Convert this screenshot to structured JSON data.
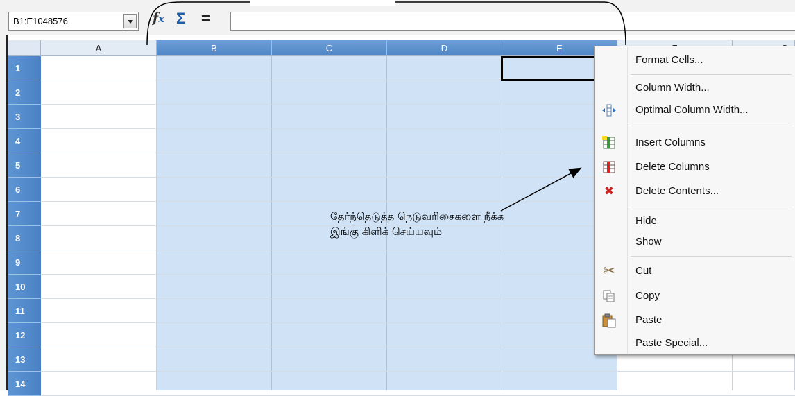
{
  "formula_bar": {
    "name_box": "B1:E1048576",
    "formula": ""
  },
  "columns": [
    {
      "name": "A",
      "selected": false
    },
    {
      "name": "B",
      "selected": true
    },
    {
      "name": "C",
      "selected": true
    },
    {
      "name": "D",
      "selected": true
    },
    {
      "name": "E",
      "selected": true
    },
    {
      "name": "F",
      "selected": false
    },
    {
      "name": "G",
      "selected": false
    }
  ],
  "rows": [
    "1",
    "2",
    "3",
    "4",
    "5",
    "6",
    "7",
    "8",
    "9",
    "10",
    "11",
    "12",
    "13",
    "14"
  ],
  "context_menu": {
    "items": [
      {
        "label": "Format Cells...",
        "icon": ""
      },
      {
        "label": "Column Width...",
        "icon": ""
      },
      {
        "label": "Optimal Column Width...",
        "icon": "optimal-width-icon"
      },
      {
        "label": "Insert Columns",
        "icon": "insert-columns-icon"
      },
      {
        "label": "Delete Columns",
        "icon": "delete-columns-icon"
      },
      {
        "label": "Delete Contents...",
        "icon": "delete-contents-icon"
      },
      {
        "label": "Hide",
        "icon": ""
      },
      {
        "label": "Show",
        "icon": ""
      },
      {
        "label": "Cut",
        "icon": "scissors-icon"
      },
      {
        "label": "Copy",
        "icon": "copy-icon"
      },
      {
        "label": "Paste",
        "icon": "paste-icon"
      },
      {
        "label": "Paste Special...",
        "icon": ""
      }
    ]
  },
  "annotation": {
    "line1": "தேர்ந்தெடுத்த நெடுவரிசைகளை நீக்க",
    "line2": "இங்கு கிளிக் செய்யவும்"
  },
  "colors": {
    "selection_fill": "#cfe2f6",
    "selected_header": "#4f86c6",
    "delete_red": "#cc2222"
  }
}
